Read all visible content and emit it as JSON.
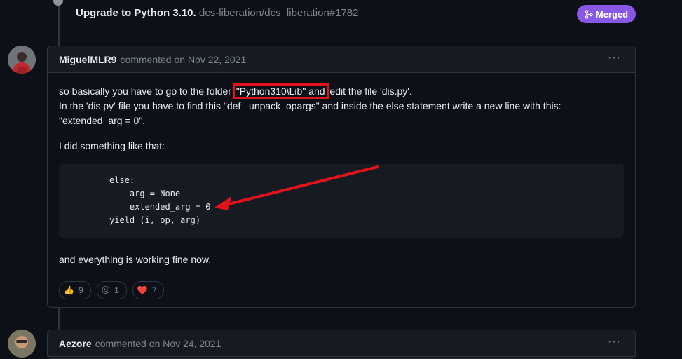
{
  "reference": {
    "title": "Upgrade to Python 3.10.",
    "subtitle": "dcs-liberation/dcs_liberation#1782",
    "badge": "Merged"
  },
  "comment1": {
    "author": "MiguelMLR9",
    "meta": "commented on Nov 22, 2021",
    "menu": "···",
    "line1_before": "so basically you have to go to the folder ",
    "line1_highlight": "\"Python310\\Lib\" and",
    "line1_after": " edit the file 'dis.py'.",
    "line2": "In the 'dis.py' file you have to find this \"def _unpack_opargs\" and inside the else statement write a new line with this:",
    "line3": "\"extended_arg = 0\".",
    "para2": "I did something like that:",
    "code": [
      "else:",
      "    arg = None",
      "    extended_arg = 0",
      "yield (i, op, arg)"
    ],
    "para3": "and everything is working fine now.",
    "reactions": [
      {
        "emoji": "👍",
        "count": "9",
        "name": "thumbs-up"
      },
      {
        "emoji": "😕",
        "count": "1",
        "name": "confused"
      },
      {
        "emoji": "❤️",
        "count": "7",
        "name": "heart"
      }
    ]
  },
  "comment2": {
    "author": "Aezore",
    "meta": "commented on Nov 24, 2021",
    "menu": "···"
  },
  "colors": {
    "background": "#0d1117",
    "merged": "#8957e5",
    "annotation_red": "#e1121b"
  }
}
